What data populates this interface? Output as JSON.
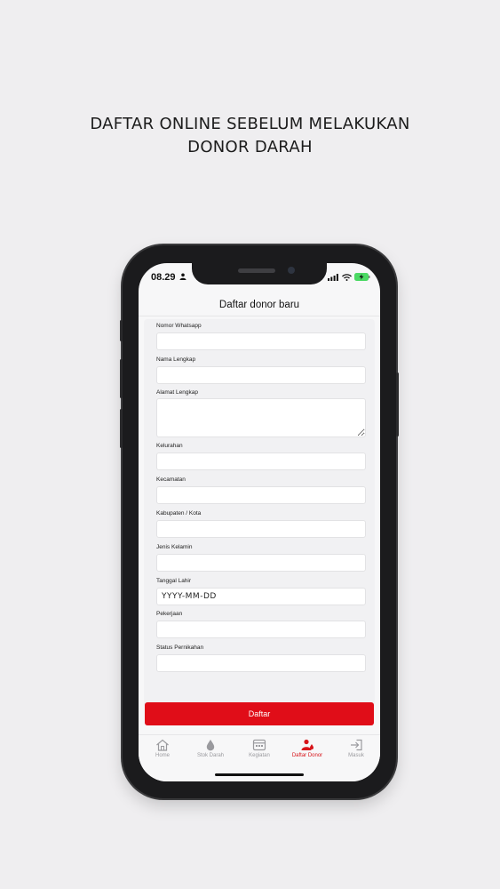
{
  "headline": {
    "line1": "DAFTAR ONLINE SEBELUM MELAKUKAN",
    "line2": "DONOR DARAH"
  },
  "status_bar": {
    "time": "08.29"
  },
  "header": {
    "title": "Daftar donor baru"
  },
  "form": {
    "fields": [
      {
        "label": "Nomor Whatsapp",
        "value": ""
      },
      {
        "label": "Nama Lengkap",
        "value": ""
      },
      {
        "label": "Alamat Lengkap",
        "value": ""
      },
      {
        "label": "Kelurahan",
        "value": ""
      },
      {
        "label": "Kecamatan",
        "value": ""
      },
      {
        "label": "Kabupaten / Kota",
        "value": ""
      },
      {
        "label": "Jenis Kelamin",
        "value": ""
      },
      {
        "label": "Tanggal Lahir",
        "value": "",
        "placeholder": "YYYY-MM-DD"
      },
      {
        "label": "Pekerjaan",
        "value": ""
      },
      {
        "label": "Status Pernikahan",
        "value": ""
      }
    ],
    "submit_label": "Daftar"
  },
  "tab_bar": {
    "items": [
      {
        "label": "Home",
        "icon": "home-icon"
      },
      {
        "label": "Stok Darah",
        "icon": "blood-drop-icon"
      },
      {
        "label": "Kegiatan",
        "icon": "calendar-icon"
      },
      {
        "label": "Daftar Donor",
        "icon": "donor-icon",
        "active": true
      },
      {
        "label": "Masuk",
        "icon": "login-icon"
      }
    ]
  },
  "colors": {
    "accent": "#e00d18",
    "background": "#efeef0",
    "tab_inactive": "#9a9a9e"
  }
}
